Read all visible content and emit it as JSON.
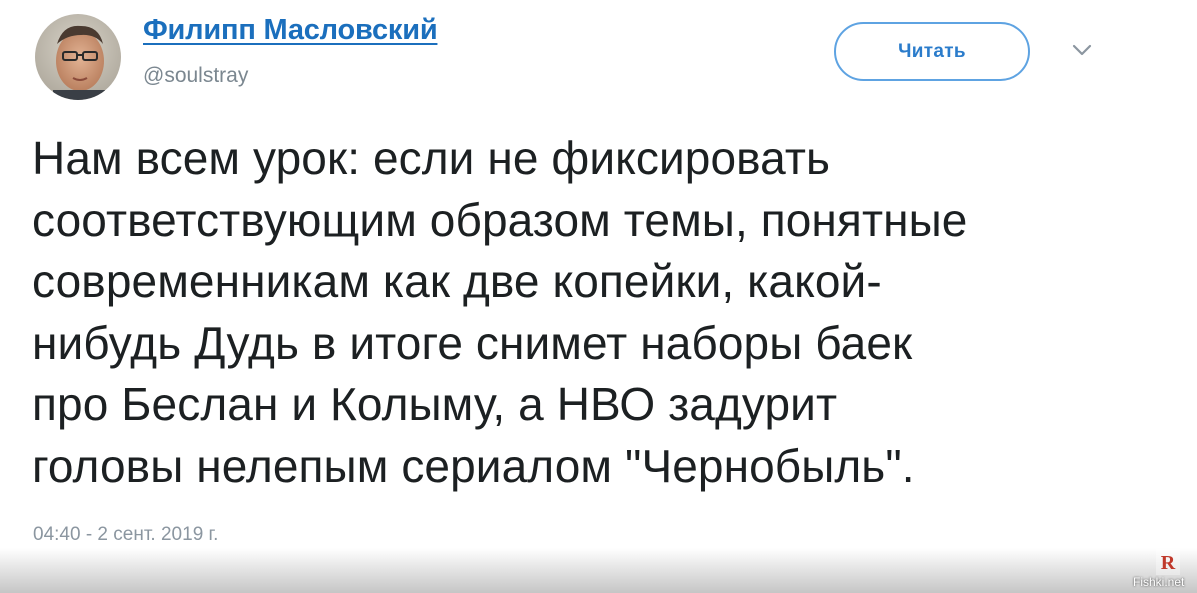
{
  "tweet": {
    "author_name": "Филипп Масловский",
    "author_handle": "@soulstray",
    "follow_label": "Читать",
    "text": "Нам всем урок: если не фиксировать\nсоответствующим образом темы, понятные\nсовременникам как две копейки, какой-\nнибудь Дудь в итоге снимет наборы баек\nпро Беслан и Колыму, а НВО задурит\nголовы нелепым сериалом \"Чернобыль\".",
    "timestamp": "04:40 - 2 сент. 2019 г."
  },
  "icons": {
    "menu": "chevron-down-icon",
    "watermark": "fishki-logo-icon"
  },
  "watermark": {
    "logo_letter": "R",
    "site": "Fishki.net"
  },
  "colors": {
    "name_link": "#1b6fbd",
    "button_border": "#5ea3e2",
    "button_text": "#2b7ccb",
    "muted_text": "#8b96a0",
    "body_text": "#1c2022"
  }
}
